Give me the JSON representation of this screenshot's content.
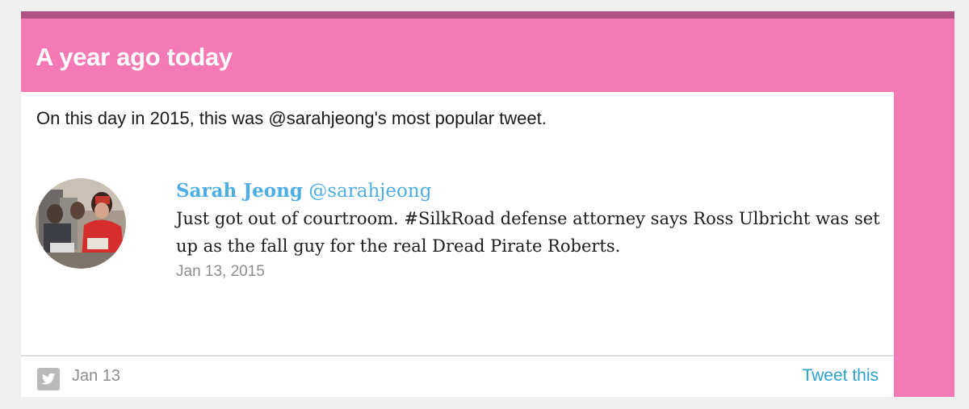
{
  "card": {
    "title": "A year ago today",
    "intro": "On this day in 2015, this was @sarahjeong's most popular tweet."
  },
  "tweet": {
    "name": "Sarah Jeong",
    "handle": "@sarahjeong",
    "text": "Just got out of courtroom. #SilkRoad defense attorney says Ross Ulbricht was set up as the fall guy for the real Dread Pirate Roberts.",
    "date": "Jan 13, 2015",
    "avatar_icon": "profile-photo"
  },
  "footer": {
    "icon": "twitter-icon",
    "date": "Jan 13",
    "action_label": "Tweet this"
  },
  "colors": {
    "accent_pink": "#f479b4",
    "accent_pink_dark": "#b04f84",
    "twitter_blue": "#4daee6",
    "link_blue": "#29a2cd",
    "muted_gray": "#8d8d8d"
  }
}
